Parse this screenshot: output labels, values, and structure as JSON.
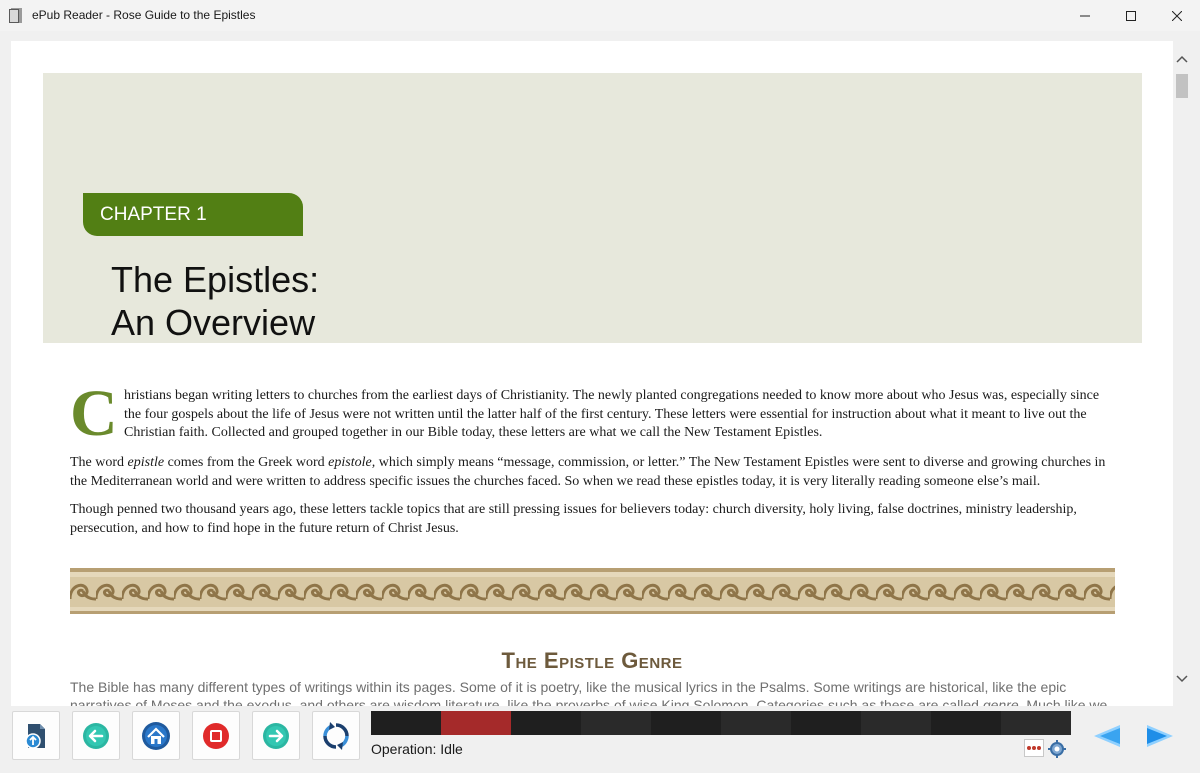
{
  "window": {
    "title": "ePub Reader - Rose Guide to the Epistles",
    "icon": "book-app-icon"
  },
  "page": {
    "chapter_label": "CHAPTER 1",
    "chapter_title_line1": "The Epistles:",
    "chapter_title_line2": "An Overview",
    "dropcap": "C",
    "paragraph1": "hristians began writing letters to churches from the earliest days of Christianity. The newly planted congregations needed to know more about who Jesus was, especially since the four gospels about the life of Jesus were not written until the latter half of the first century. These letters were essential for instruction about what it meant to live out the Christian faith. Collected and grouped together in our Bible today, these letters are what we call the New Testament Epistles.",
    "paragraph2_a": "The word ",
    "paragraph2_em1": "epistle",
    "paragraph2_b": " comes from the Greek word ",
    "paragraph2_em2": "epistole,",
    "paragraph2_c": " which simply means “message, commission, or letter.” The New Testament Epistles were sent to diverse and growing churches in the Mediterranean world and were written to address specific issues the churches faced. So when we read these epistles today, it is very literally reading someone else’s mail.",
    "paragraph3": "Though penned two thousand years ago, these letters tackle topics that are still pressing issues for believers today: church diversity, holy living, false doctrines, ministry leadership, persecution, and how to find hope in the future return of Christ Jesus.",
    "section_title": "The Epistle Genre",
    "section_text_a": "The Bible has many different types of writings within its pages. Some of it is poetry, like the musical lyrics in the Psalms. Some writings are historical, like the epic narratives of Moses and the exodus, and others are wisdom literature, like the proverbs of wise King Solomon. Categories such as these are called ",
    "section_text_em": "genre",
    "section_text_b": ". Much like we"
  },
  "toolbar": {
    "buttons": [
      "open-file",
      "back",
      "home",
      "stop",
      "forward",
      "refresh"
    ],
    "operation_status": "Operation: Idle",
    "progress_segments": [
      "#1f1f1f",
      "#a52a2a",
      "#1f1f1f",
      "#2a2a2a",
      "#1f1f1f",
      "#2a2a2a",
      "#1f1f1f",
      "#2a2a2a",
      "#1f1f1f",
      "#2a2a2a"
    ]
  },
  "colors": {
    "chapter_green": "#527f14",
    "banner_bg": "#e7e8dc",
    "heading_brown": "#6d5a3c",
    "nav_blue": "#1e90ff"
  }
}
